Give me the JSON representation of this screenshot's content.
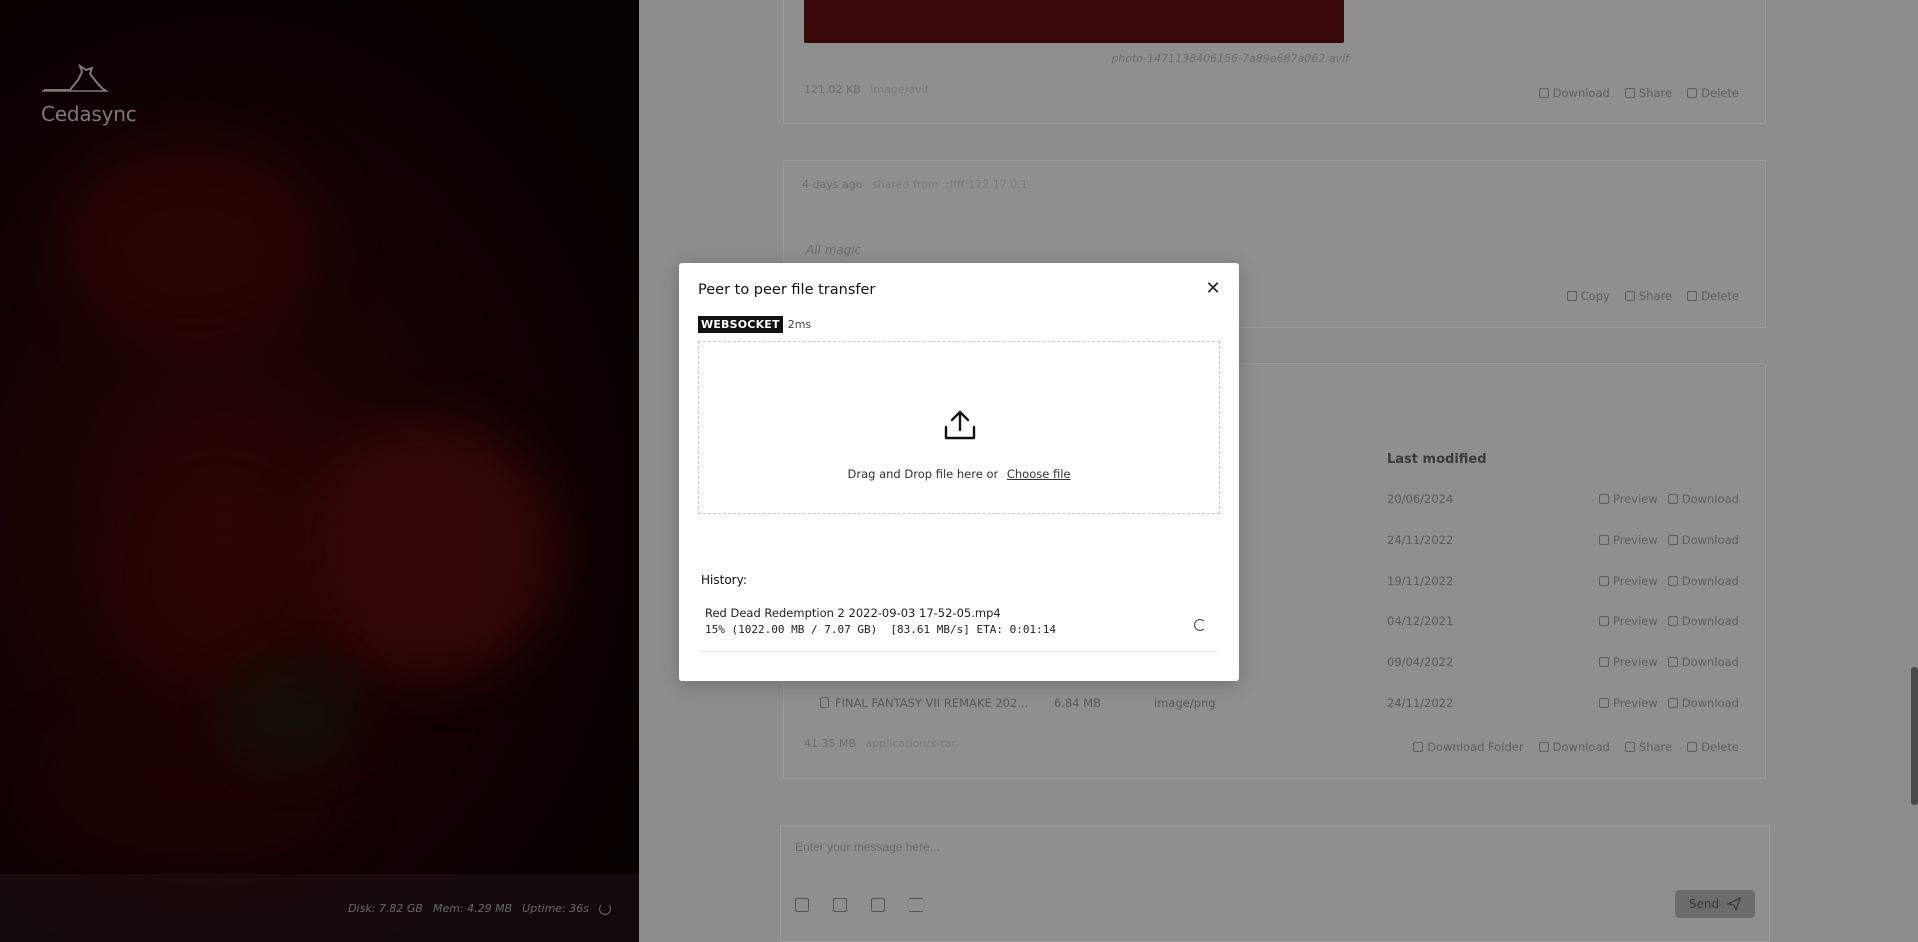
{
  "app": {
    "brand": "Cedasync"
  },
  "status": {
    "disk": "Disk: 7.82 GB",
    "mem": "Mem: 4.29 MB",
    "uptime": "Uptime: 36s"
  },
  "feed": {
    "card1": {
      "filename": "photo-1471138406156-7a89e687a062.avif",
      "size": "121.02 KB",
      "type": "image/avif",
      "actions": [
        "Download",
        "Share",
        "Delete"
      ]
    },
    "card2": {
      "time": "4 days ago",
      "origin": "shared from ::ffff:172.17.0.1",
      "message": "All magic",
      "actions": [
        "Copy",
        "Share",
        "Delete"
      ]
    },
    "card3": {
      "columns": [
        "Last modified"
      ],
      "rows": [
        {
          "name": "",
          "size": "",
          "type": "",
          "modified": "20/06/2024"
        },
        {
          "name": "",
          "size": "",
          "type": "",
          "modified": "24/11/2022"
        },
        {
          "name": "",
          "size": "",
          "type": "",
          "modified": "19/11/2022"
        },
        {
          "name": "",
          "size": "",
          "type": "",
          "modified": "04/12/2021"
        },
        {
          "name": "",
          "size": "",
          "type": "",
          "modified": "09/04/2022"
        },
        {
          "name": "FINAL FANTASY VII REMAKE 202...",
          "size": "6.84 MB",
          "type": "image/png",
          "modified": "24/11/2022"
        }
      ],
      "row_actions": [
        "Preview",
        "Download"
      ],
      "size": "41.35 MB",
      "type": "application/x-tar",
      "actions": [
        "Download Folder",
        "Download",
        "Share",
        "Delete"
      ]
    }
  },
  "composer": {
    "placeholder": "Enter your message here...",
    "send_label": "Send"
  },
  "modal": {
    "title": "Peer to peer file transfer",
    "protocol": "WEBSOCKET",
    "latency": "2ms",
    "drop_text": "Drag and Drop file here or",
    "choose_file": "Choose file",
    "history_label": "History:",
    "history": [
      {
        "name": "Red Dead Redemption 2 2022-09-03 17-52-05.mp4",
        "progress": "15% (1022.00 MB / 7.07 GB)  [83.61 MB/s] ETA: 0:01:14"
      }
    ]
  }
}
